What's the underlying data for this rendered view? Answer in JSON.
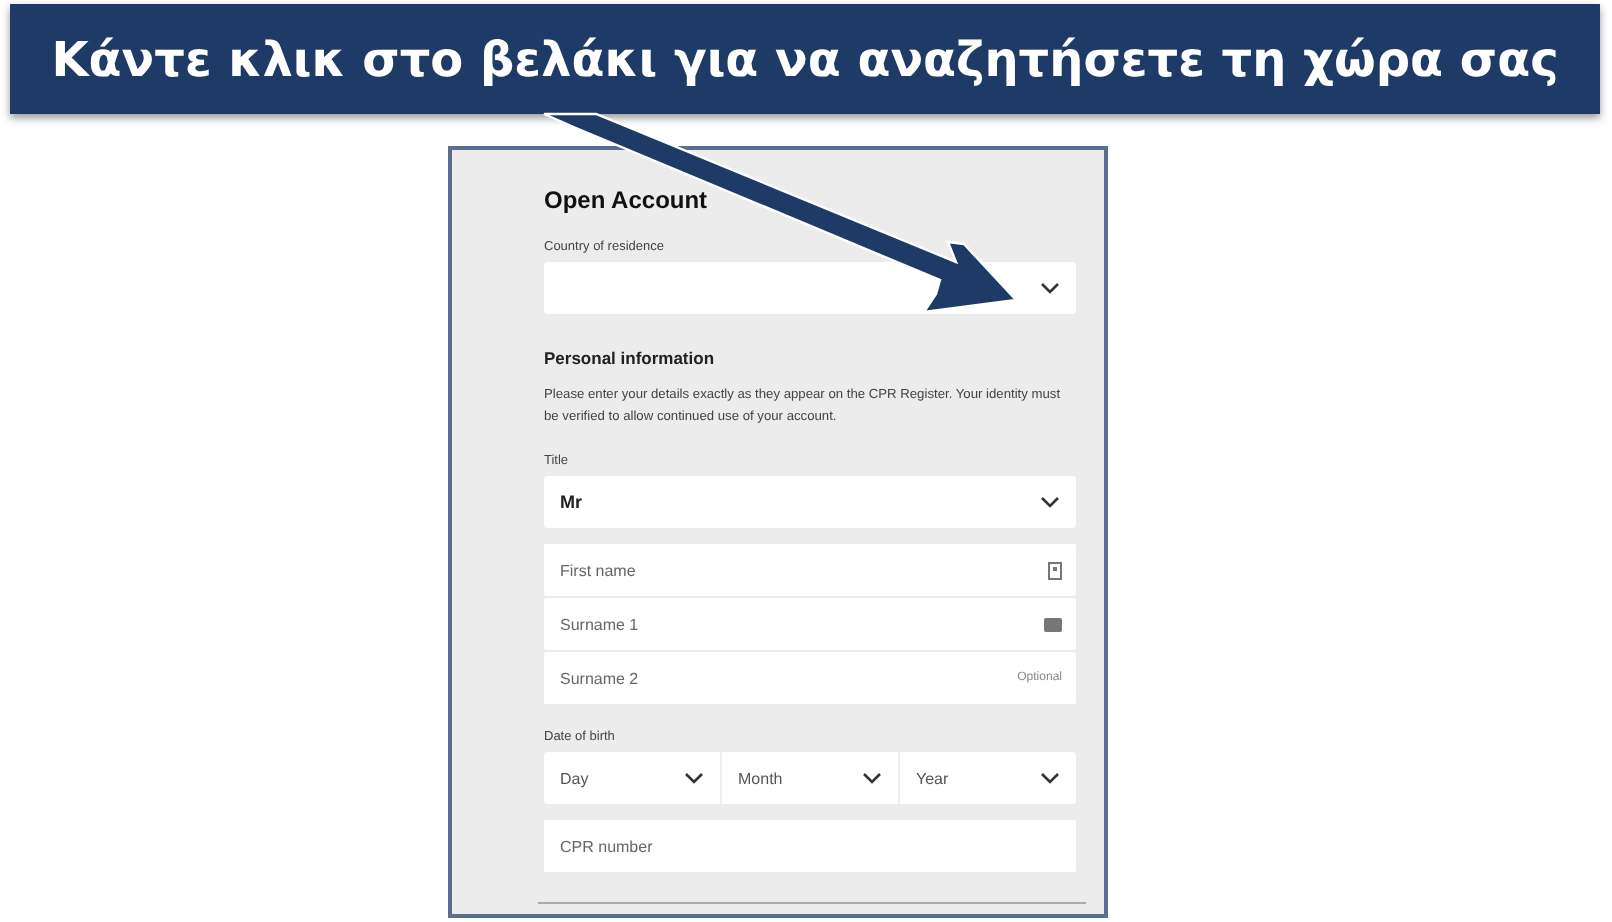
{
  "callout": {
    "text": "Κάντε κλικ στο βελάκι για να αναζητήσετε τη χώρα σας"
  },
  "form": {
    "title": "Open Account",
    "country": {
      "label": "Country of residence"
    },
    "section_title": "Personal information",
    "note": "Please enter your details exactly as they appear on the CPR Register. Your identity must be verified to allow continued use of your account.",
    "title_field": {
      "label": "Title",
      "value": "Mr"
    },
    "name_fields": [
      {
        "placeholder": "First name",
        "kind": "contact"
      },
      {
        "placeholder": "Surname 1",
        "kind": "card"
      },
      {
        "placeholder": "Surname 2",
        "kind": "optional",
        "hint": "Optional"
      }
    ],
    "dob": {
      "label": "Date of birth",
      "parts": [
        "Day",
        "Month",
        "Year"
      ]
    },
    "cpr": {
      "placeholder": "CPR number"
    }
  }
}
